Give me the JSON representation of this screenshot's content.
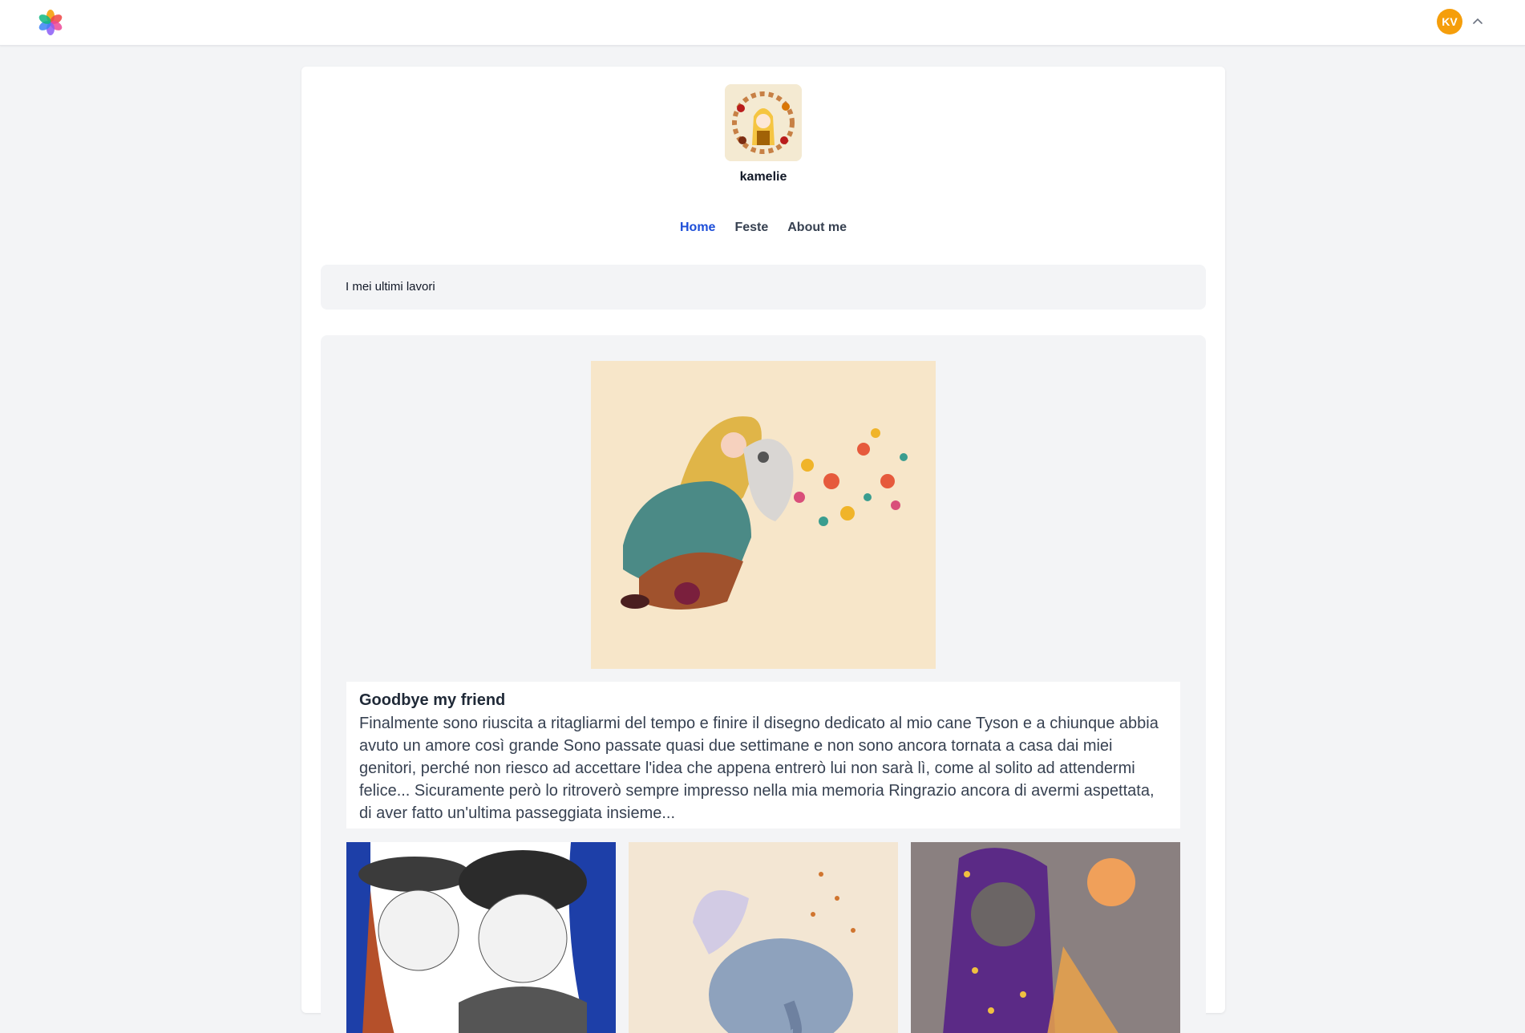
{
  "header": {
    "logo_icon": "pinwheel-logo-icon",
    "user_initials": "KV",
    "user_avatar_color": "#f59e0b",
    "menu_icon": "chevron-up-icon"
  },
  "profile": {
    "username": "kamelie"
  },
  "nav": {
    "items": [
      {
        "label": "Home",
        "active": true
      },
      {
        "label": "Feste",
        "active": false
      },
      {
        "label": "About me",
        "active": false
      }
    ]
  },
  "section": {
    "title": "I mei ultimi lavori"
  },
  "featured_post": {
    "title": "Goodbye my friend",
    "excerpt": "Finalmente sono riuscita a ritagliarmi del tempo e finire il disegno dedicato al mio cane Tyson e a chiunque abbia avuto un amore così grande Sono passate quasi due settimane e non sono ancora tornata a casa dai miei genitori, perché non riesco ad accettare l'idea che appena entrerò lui non sarà lì, come al solito ad attendermi felice... Sicuramente però lo ritroverò sempre impresso nella mia memoria  Ringrazio ancora di avermi aspettata, di aver fatto un'ultima passeggiata insieme..."
  },
  "colors": {
    "accent": "#1d4ed8",
    "page_bg": "#f3f4f6"
  }
}
